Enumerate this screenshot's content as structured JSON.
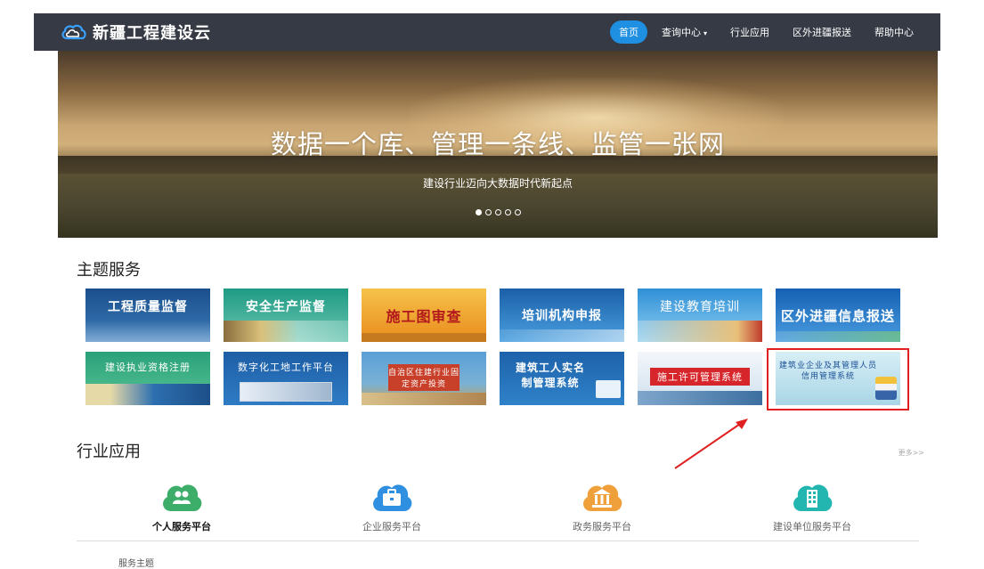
{
  "nav": {
    "brand": "新疆工程建设云",
    "items": [
      {
        "label": "首页",
        "active": true
      },
      {
        "label": "查询中心",
        "dropdown": true
      },
      {
        "label": "行业应用"
      },
      {
        "label": "区外进疆报送"
      },
      {
        "label": "帮助中心"
      }
    ]
  },
  "banner": {
    "title": "数据一个库、管理一条线、监管一张网",
    "subtitle": "建设行业迈向大数据时代新起点",
    "slide_count": 5,
    "active_slide": 1
  },
  "theme_services": {
    "title": "主题服务",
    "tiles": [
      {
        "label": "工程质量监督",
        "color": "#1f5e9e"
      },
      {
        "label": "安全生产监督",
        "color": "#27a08a"
      },
      {
        "label": "施工图审查",
        "color": "#f0a431"
      },
      {
        "label": "培训机构申报",
        "color": "#2e7fc6"
      },
      {
        "label": "建设教育培训",
        "color": "#3a9fd8"
      },
      {
        "label": "区外进疆信息报送",
        "color": "#1c74c4"
      },
      {
        "label": "建设执业资格注册",
        "color": "#2fa67a"
      },
      {
        "label": "数字化工地工作平台",
        "color": "#1f63a6"
      },
      {
        "label": "自治区住建行业固定资产投资",
        "color": "#3f8bc9"
      },
      {
        "label": "建筑工人实名制管理系统",
        "color": "#2275b8"
      },
      {
        "label": "施工许可管理系统",
        "color": "#dfe9f2"
      },
      {
        "label": "建筑业企业及其管理人员信用管理系统",
        "color": "#bfe0ee"
      }
    ]
  },
  "industry_apps": {
    "title": "行业应用",
    "more": "更多>>",
    "apps": [
      {
        "label": "个人服务平台",
        "color": "#3cae6a",
        "active": true
      },
      {
        "label": "企业服务平台",
        "color": "#2f8fe0"
      },
      {
        "label": "政务服务平台",
        "color": "#f0a03a"
      },
      {
        "label": "建设单位服务平台",
        "color": "#23b6b0"
      }
    ]
  },
  "footer_label": "服务主题"
}
